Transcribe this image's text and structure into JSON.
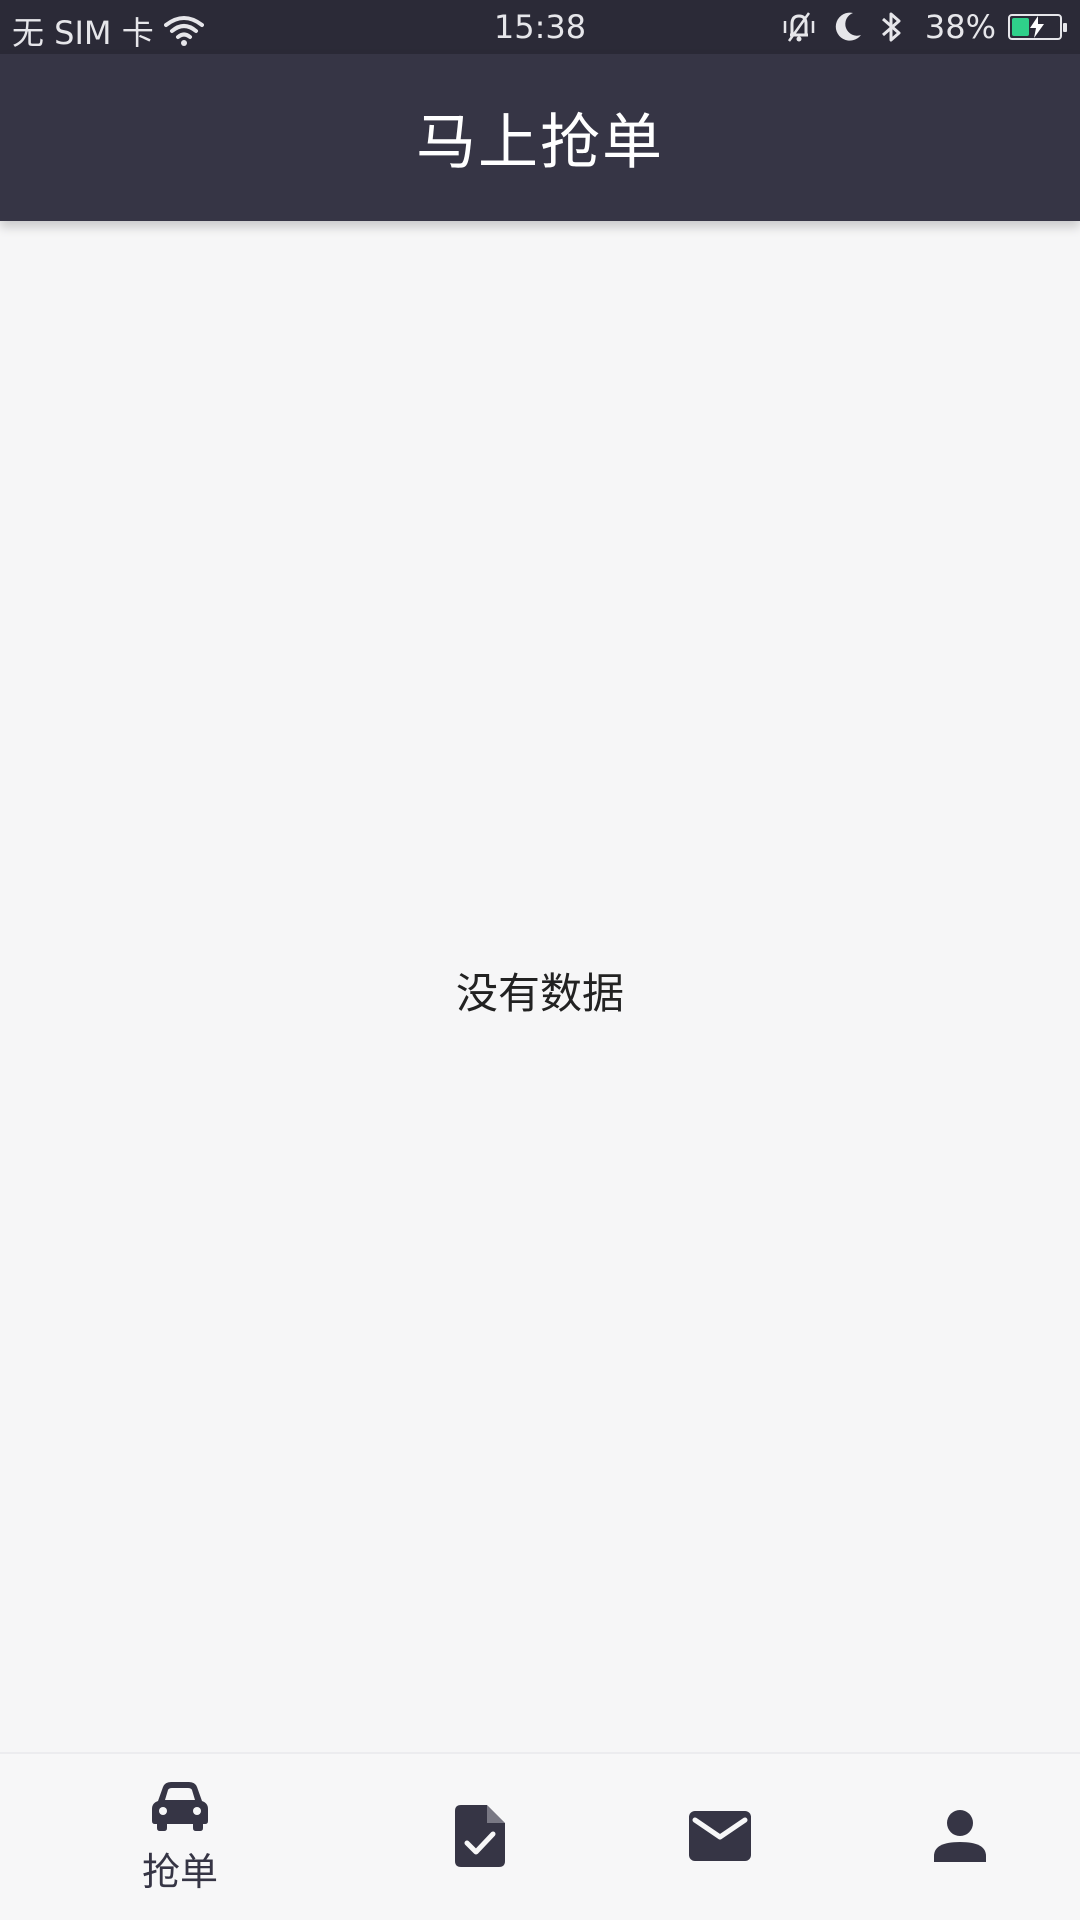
{
  "status_bar": {
    "carrier": "无 SIM 卡",
    "time": "15:38",
    "battery_percent": "38%",
    "battery_level": 0.38,
    "icons": [
      "wifi-icon",
      "vibrate-icon",
      "moon-icon",
      "bluetooth-icon",
      "battery-icon"
    ]
  },
  "app_bar": {
    "title": "马上抢单"
  },
  "content": {
    "empty_message": "没有数据"
  },
  "bottom_nav": {
    "items": [
      {
        "label": "抢单",
        "icon": "car-icon",
        "active": true
      },
      {
        "label": "",
        "icon": "file-check-icon",
        "active": false
      },
      {
        "label": "",
        "icon": "mail-icon",
        "active": false
      },
      {
        "label": "",
        "icon": "person-icon",
        "active": false
      }
    ]
  },
  "colors": {
    "status_bar_bg": "#2b2a37",
    "app_bar_bg": "#363545",
    "page_bg": "#f6f6f7",
    "nav_icon": "#363545",
    "battery_fill": "#2fd08a"
  }
}
